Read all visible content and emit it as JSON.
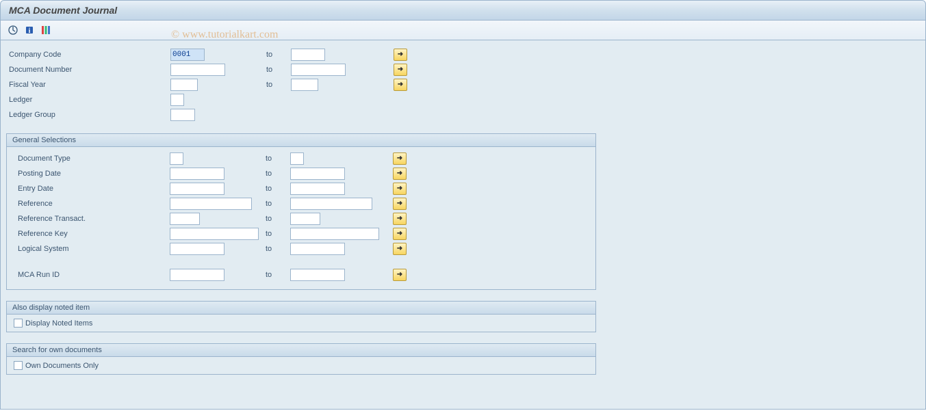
{
  "title": "MCA Document Journal",
  "watermark": "© www.tutorialkart.com",
  "toolbar": {
    "execute": "execute-icon",
    "info": "info-icon",
    "variants": "variants-icon"
  },
  "labels": {
    "company_code": "Company Code",
    "document_number": "Document Number",
    "fiscal_year": "Fiscal Year",
    "ledger": "Ledger",
    "ledger_group": "Ledger Group",
    "to": "to"
  },
  "values": {
    "company_code_from": "0001",
    "company_code_to": "",
    "document_number_from": "",
    "document_number_to": "",
    "fiscal_year_from": "",
    "fiscal_year_to": "",
    "ledger": "",
    "ledger_group": ""
  },
  "group_general": {
    "title": "General Selections",
    "labels": {
      "document_type": "Document Type",
      "posting_date": "Posting Date",
      "entry_date": "Entry Date",
      "reference": "Reference",
      "reference_transact": "Reference Transact.",
      "reference_key": "Reference Key",
      "logical_system": "Logical System",
      "mca_run_id": "MCA Run ID"
    }
  },
  "group_noted": {
    "title": "Also display noted item",
    "checkbox": "Display Noted Items"
  },
  "group_own": {
    "title": "Search for own documents",
    "checkbox": "Own Documents Only"
  }
}
